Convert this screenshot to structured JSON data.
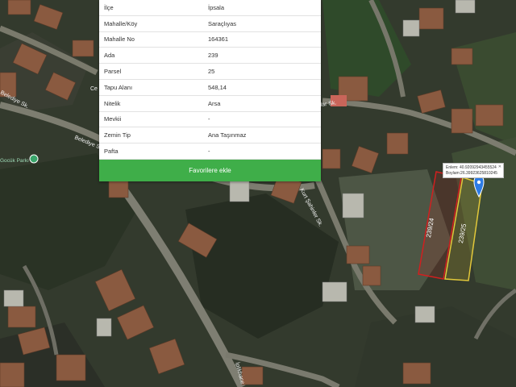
{
  "panel": {
    "rows": [
      {
        "label": "İlçe",
        "value": "İpsala"
      },
      {
        "label": "Mahalle/Köy",
        "value": "Saraçlıyas"
      },
      {
        "label": "Mahalle No",
        "value": "164361"
      },
      {
        "label": "Ada",
        "value": "239"
      },
      {
        "label": "Parsel",
        "value": "25"
      },
      {
        "label": "Tapu Alanı",
        "value": "548,14"
      },
      {
        "label": "Nitelik",
        "value": "Arsa"
      },
      {
        "label": "Mevkii",
        "value": "-"
      },
      {
        "label": "Zemin Tip",
        "value": "Ana Taşınmaz"
      },
      {
        "label": "Pafta",
        "value": "-"
      }
    ],
    "button_label": "Favorilere ekle"
  },
  "coord_popup": {
    "lat": "Enlem: 40.92092943455524",
    "lon": "Boylam:26.39923625810245"
  },
  "map": {
    "road_labels": {
      "belediye_1": "Belediye Sk.",
      "belediye_2": "Belediye Sk.",
      "lar_sk": "lar Sk.",
      "sahinler_sk": "Kurt Şahinler Sk.",
      "iplik": "İplikhane",
      "ce": "Ce"
    },
    "park_label": "Gocük Parkı",
    "parcel_labels": {
      "red": "239/24",
      "yellow": "239/25"
    },
    "watermark": "sahibinden"
  },
  "colors": {
    "button_green": "#3fae49",
    "parcel_red": "#d11f1f",
    "parcel_yellow": "#e2c83a",
    "pin_blue": "#2c7be5"
  }
}
